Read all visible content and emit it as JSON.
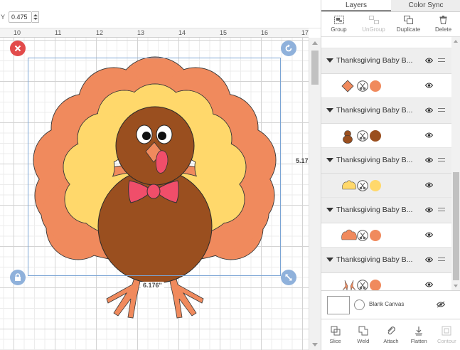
{
  "topbar": {
    "y_label": "Y",
    "y_value": "0.475"
  },
  "ruler": {
    "labels": [
      "10",
      "11",
      "12",
      "13",
      "14",
      "15",
      "16",
      "17"
    ]
  },
  "selection": {
    "height_label": "5.17",
    "width_label": "6.176\""
  },
  "panel": {
    "tabs": [
      "Layers",
      "Color Sync"
    ],
    "toolbar": [
      {
        "label": "Group",
        "icon": "group-icon",
        "enabled": true
      },
      {
        "label": "UnGroup",
        "icon": "ungroup-icon",
        "enabled": false
      },
      {
        "label": "Duplicate",
        "icon": "duplicate-icon",
        "enabled": true
      },
      {
        "label": "Delete",
        "icon": "trash-icon",
        "enabled": true
      }
    ],
    "groups": [
      {
        "name": "Thanksgiving Baby B...",
        "layer_color": "#f08a5d",
        "thumb": "beak-diamond"
      },
      {
        "name": "Thanksgiving Baby B...",
        "layer_color": "#9a4f1f",
        "thumb": "body"
      },
      {
        "name": "Thanksgiving Baby B...",
        "layer_color": "#ffd86b",
        "thumb": "feathers-inner"
      },
      {
        "name": "Thanksgiving Baby B...",
        "layer_color": "#f08a5d",
        "thumb": "feathers-outer"
      },
      {
        "name": "Thanksgiving Baby B...",
        "layer_color": "#f08a5d",
        "thumb": "feet"
      }
    ],
    "blank_canvas_label": "Blank Canvas",
    "bottom_tools": [
      {
        "label": "Slice",
        "icon": "slice-icon",
        "enabled": true
      },
      {
        "label": "Weld",
        "icon": "weld-icon",
        "enabled": true
      },
      {
        "label": "Attach",
        "icon": "attach-icon",
        "enabled": true
      },
      {
        "label": "Flatten",
        "icon": "flatten-icon",
        "enabled": true
      },
      {
        "label": "Contour",
        "icon": "contour-icon",
        "enabled": false
      }
    ]
  },
  "colors": {
    "feather_outer": "#f08a5d",
    "feather_inner": "#ffd86b",
    "body": "#9a4f1f",
    "bow": "#f04e6a",
    "selection": "#7aa4d4",
    "delete_handle": "#e24b4b"
  }
}
